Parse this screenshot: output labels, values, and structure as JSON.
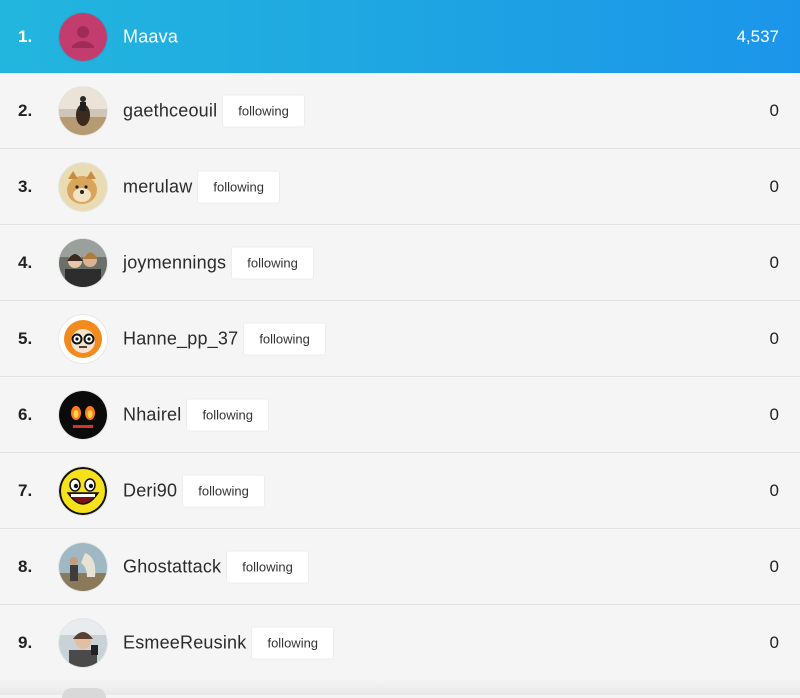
{
  "leaderboard": {
    "current_user": {
      "rank": "1.",
      "name": "Maava",
      "score": "4,537",
      "avatar_icon": "default-user-icon",
      "avatar_color": "#c23d6e"
    },
    "rows": [
      {
        "rank": "2.",
        "name": "gaethceouil",
        "badge": "following",
        "score": "0",
        "avatar_icon": "horse-rider-photo"
      },
      {
        "rank": "3.",
        "name": "merulaw",
        "badge": "following",
        "score": "0",
        "avatar_icon": "doge-photo"
      },
      {
        "rank": "4.",
        "name": "joymennings",
        "badge": "following",
        "score": "0",
        "avatar_icon": "friends-photo"
      },
      {
        "rank": "5.",
        "name": "Hanne_pp_37",
        "badge": "following",
        "score": "0",
        "avatar_icon": "nerd-cartoon"
      },
      {
        "rank": "6.",
        "name": "Nhairel",
        "badge": "following",
        "score": "0",
        "avatar_icon": "fire-eyes"
      },
      {
        "rank": "7.",
        "name": "Deri90",
        "badge": "following",
        "score": "0",
        "avatar_icon": "awesome-face"
      },
      {
        "rank": "8.",
        "name": "Ghostattack",
        "badge": "following",
        "score": "0",
        "avatar_icon": "horse-photo"
      },
      {
        "rank": "9.",
        "name": "EsmeeReusink",
        "badge": "following",
        "score": "0",
        "avatar_icon": "selfie-photo"
      }
    ]
  },
  "colors": {
    "highlight_start": "#22b6de",
    "highlight_end": "#1b95ea"
  }
}
